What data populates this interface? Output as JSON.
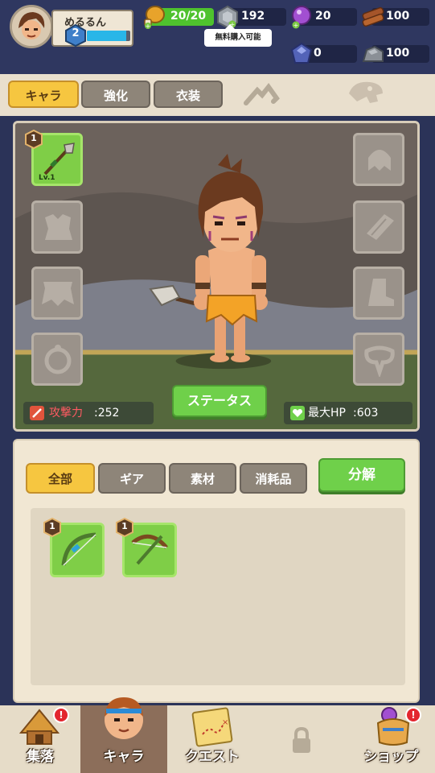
{
  "player": {
    "name": "めるるん",
    "level": "2",
    "xp_fraction": 0.9
  },
  "resources": {
    "stamina": "20/20",
    "stamina_fraction": 1.0,
    "coins": "192",
    "purple_gems": "20",
    "wood": "100",
    "blue_gems": "0",
    "stone": "100",
    "tooltip": "無料購入可能"
  },
  "tabs": [
    {
      "label": "キャラ",
      "active": true
    },
    {
      "label": "強化",
      "active": false
    },
    {
      "label": "衣装",
      "active": false
    }
  ],
  "character": {
    "weapon_level": "1",
    "weapon_lv_text": "Lv.1",
    "attack_label": "攻撃力",
    "attack_value": ":252",
    "status_button": "ステータス",
    "hp_label": "最大HP",
    "hp_value": ":603"
  },
  "inventory": {
    "filters": [
      {
        "label": "全部",
        "active": true
      },
      {
        "label": "ギア",
        "active": false
      },
      {
        "label": "素材",
        "active": false
      },
      {
        "label": "消耗品",
        "active": false
      }
    ],
    "decompose_button": "分解",
    "items": [
      {
        "name": "bow-a",
        "tier": "1"
      },
      {
        "name": "bow-b",
        "tier": "1"
      }
    ]
  },
  "nav": [
    {
      "label": "集落",
      "badge": "!",
      "active": false
    },
    {
      "label": "キャラ",
      "active": true
    },
    {
      "label": "クエスト",
      "active": false
    },
    {
      "label": "",
      "active": false,
      "locked": true
    },
    {
      "label": "ショップ",
      "badge": "!",
      "active": false
    }
  ],
  "colors": {
    "header": "#2f3760",
    "accent_yellow": "#f6c640",
    "green_button": "#6fd04a",
    "badge_red": "#e3262e"
  }
}
